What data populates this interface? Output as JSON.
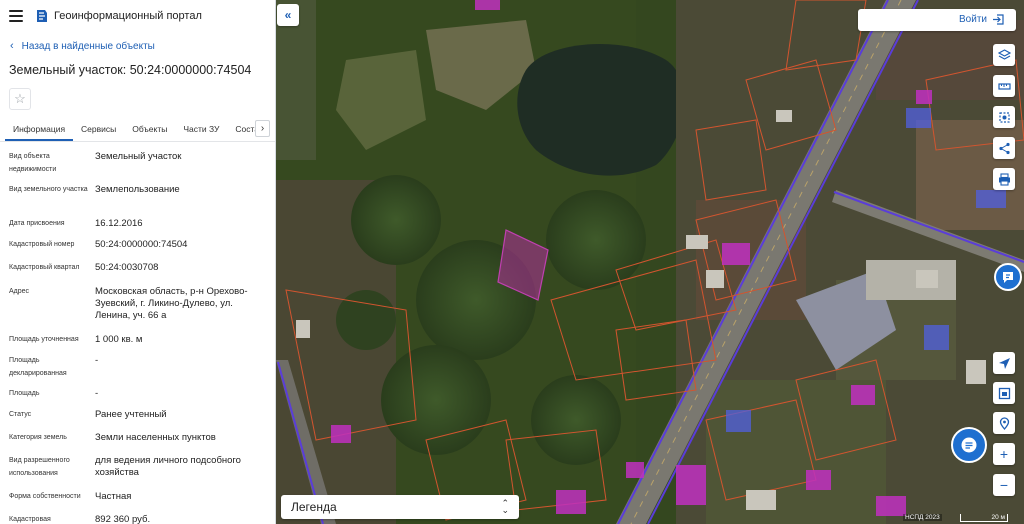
{
  "app": {
    "title": "Геоинформационный портал"
  },
  "back_link": "Назад в найденные объекты",
  "object": {
    "title": "Земельный участок: 50:24:0000000:74504"
  },
  "tabs": [
    "Информация",
    "Сервисы",
    "Объекты",
    "Части ЗУ",
    "Состав"
  ],
  "properties": [
    {
      "label": "Вид объекта недвижимости",
      "value": "Земельный участок"
    },
    {
      "label": "Вид земельного участка",
      "value": "Землепользование"
    },
    {
      "label": "Дата присвоения",
      "value": "16.12.2016"
    },
    {
      "label": "Кадастровый номер",
      "value": "50:24:0000000:74504"
    },
    {
      "label": "Кадастровый квартал",
      "value": "50:24:0030708"
    },
    {
      "label": "Адрес",
      "value": "Московская область, р-н Орехово-Зуевский, г. Ликино-Дулево, ул. Ленина, уч. 66 а"
    },
    {
      "label": "Площадь уточненная",
      "value": "1 000 кв. м"
    },
    {
      "label": "Площадь декларированная",
      "value": "-"
    },
    {
      "label": "Площадь",
      "value": "-"
    },
    {
      "label": "Статус",
      "value": "Ранее учтенный"
    },
    {
      "label": "Категория земель",
      "value": "Земли населенных пунктов"
    },
    {
      "label": "Вид разрешенного использования",
      "value": "для ведения личного подсобного хозяйства"
    },
    {
      "label": "Форма собственности",
      "value": "Частная"
    },
    {
      "label": "Кадастровая",
      "value": "892 360 руб."
    }
  ],
  "map": {
    "login_label": "Войти",
    "legend_label": "Легенда",
    "attribution": "НСПД 2023",
    "scale_label": "20 м",
    "zoom_in": "+",
    "zoom_out": "−"
  },
  "colors": {
    "accent": "#1e5fb4",
    "highlight_parcel": "#b0309a",
    "boundary": "#d2552f",
    "road_line": "#5a3dd8"
  },
  "icons": [
    "menu-icon",
    "logo-icon",
    "star-icon",
    "layers-icon",
    "ruler-icon",
    "select-area-icon",
    "share-icon",
    "print-icon",
    "help-icon",
    "location-icon",
    "basemap-icon",
    "pin-icon",
    "chat-icon",
    "login-icon"
  ]
}
